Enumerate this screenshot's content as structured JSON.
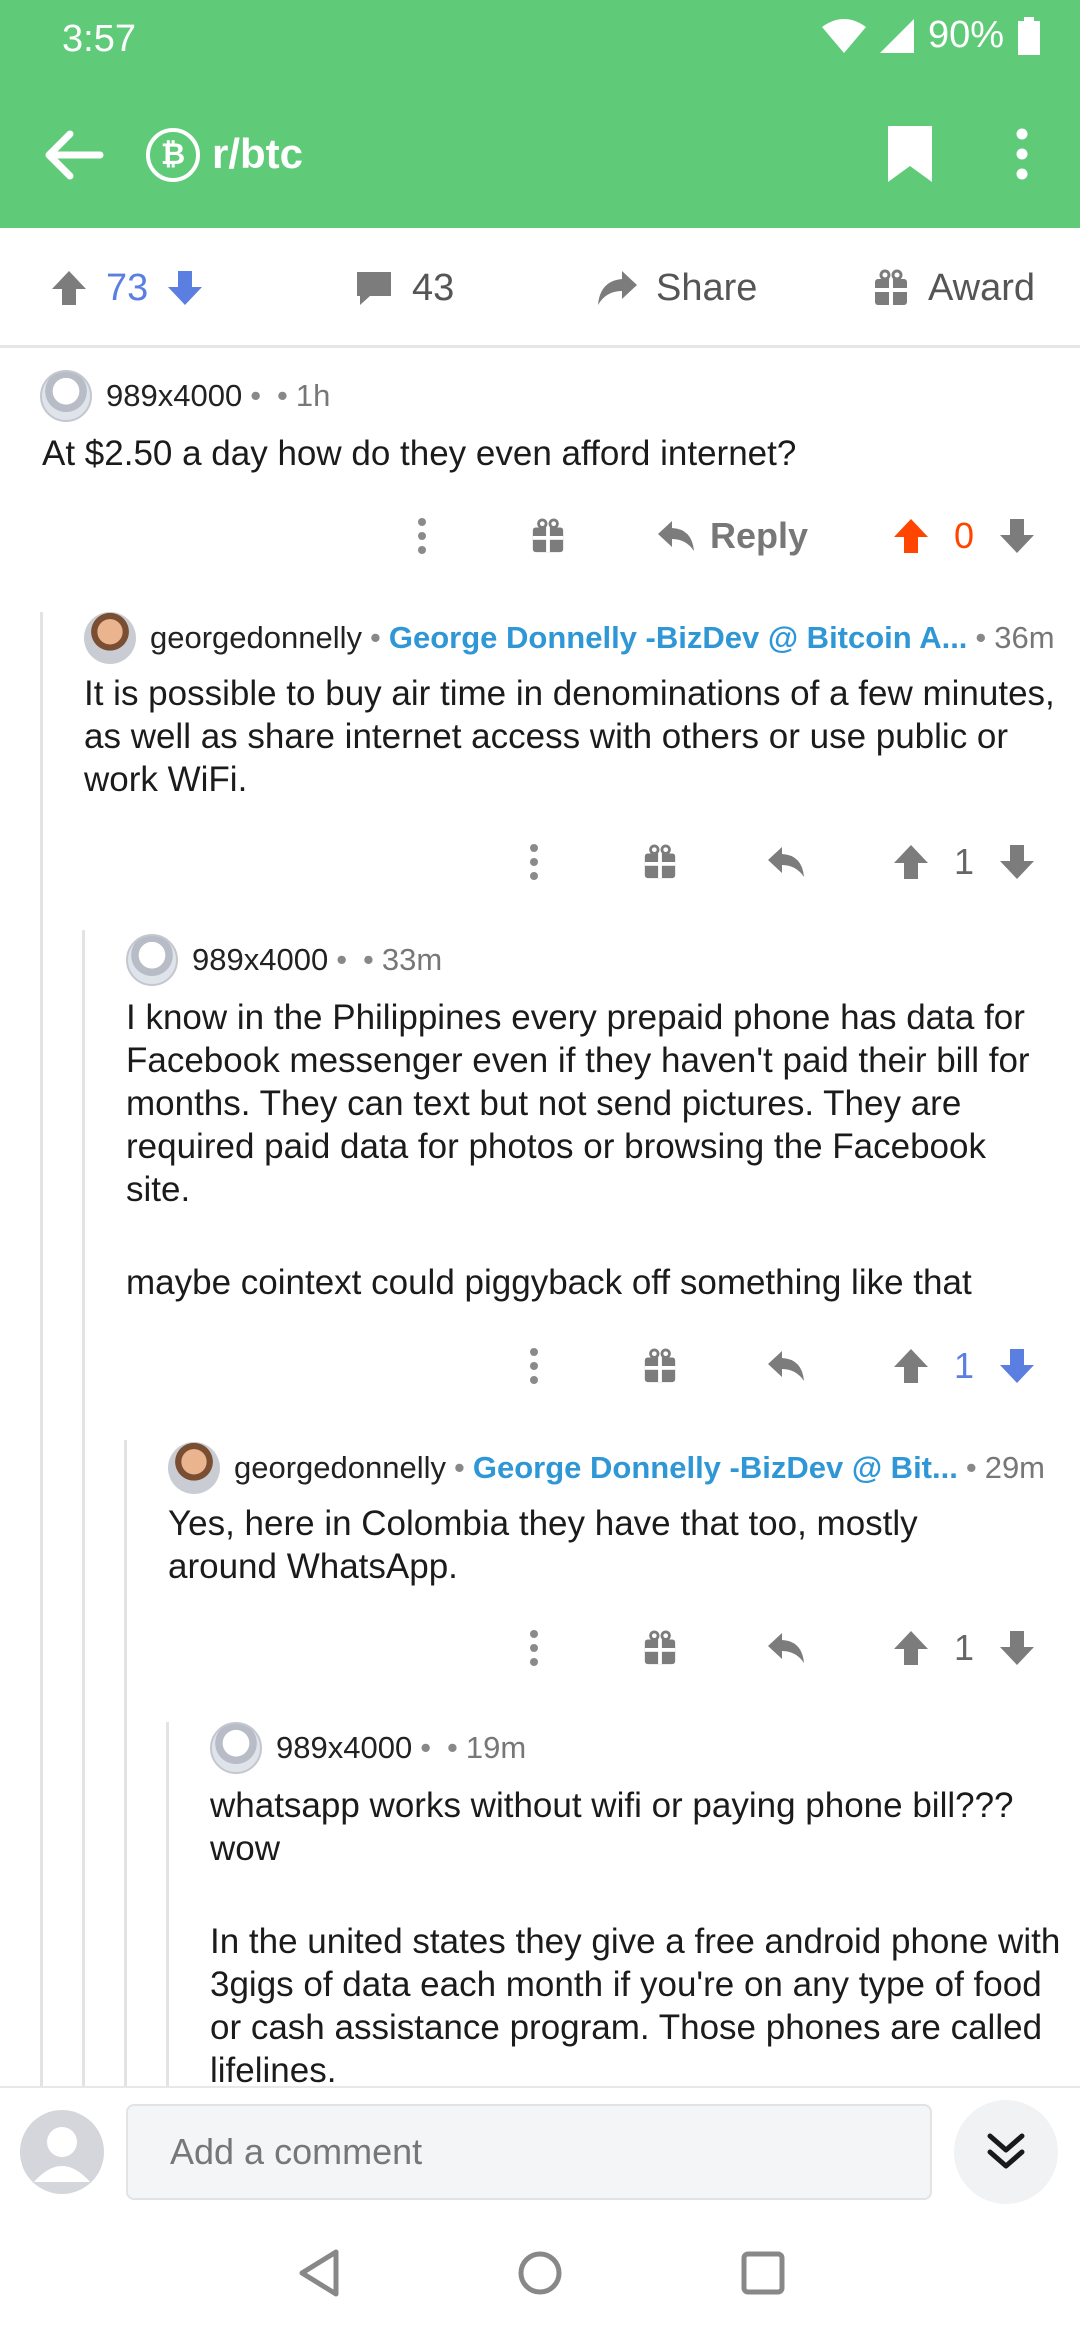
{
  "status": {
    "time": "3:57",
    "battery": "90%"
  },
  "header": {
    "subreddit": "r/btc",
    "subreddit_icon": "₿"
  },
  "post_actions": {
    "upvotes": "73",
    "comments": "43",
    "share": "Share",
    "award": "Award"
  },
  "comments": [
    {
      "author": "989x4000",
      "flair": "",
      "age": "1h",
      "body": [
        "At $2.50 a day how do they even afford internet?"
      ],
      "score": "0",
      "reply_label": "Reply"
    },
    {
      "author": "georgedonnelly",
      "flair": "George Donnelly -BizDev @ Bitcoin A...",
      "age": "36m",
      "body": [
        "It is possible to buy air time in denominations of a few minutes, as well as share internet access with others or use public or work WiFi."
      ],
      "score": "1"
    },
    {
      "author": "989x4000",
      "flair": "",
      "age": "33m",
      "body": [
        "I know in the Philippines every prepaid phone has data for Facebook messenger even if they haven't paid their bill for months. They can text but not send pictures. They are required paid data for photos or browsing the Facebook site.",
        "maybe cointext could piggyback off something like that"
      ],
      "score": "1"
    },
    {
      "author": "georgedonnelly",
      "flair": "George Donnelly -BizDev @ Bit...",
      "age": "29m",
      "body": [
        "Yes, here in Colombia they have that too, mostly around WhatsApp."
      ],
      "score": "1"
    },
    {
      "author": "989x4000",
      "flair": "",
      "age": "19m",
      "body": [
        "whatsapp works without wifi or paying phone bill??? wow",
        "In the united states they give a free android phone with 3gigs of data each month if you're on any type of food or cash assistance program. Those phones are called lifelines."
      ],
      "score": ""
    }
  ],
  "comment_bar": {
    "placeholder": "Add a comment"
  },
  "colors": {
    "header_green": "#5fcb78",
    "upvote_orange": "#ff4500",
    "vote_blue": "#5b7fe0",
    "flair_blue": "#2f97d6"
  }
}
